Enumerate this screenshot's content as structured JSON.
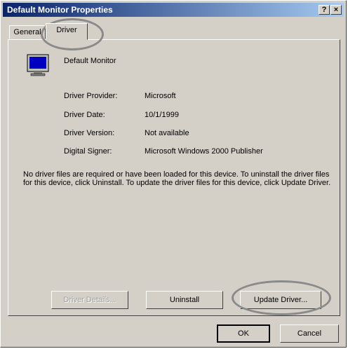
{
  "window": {
    "title": "Default Monitor Properties",
    "help_btn": "?",
    "close_btn": "×"
  },
  "tabs": [
    {
      "label": "General"
    },
    {
      "label": "Driver"
    }
  ],
  "device": {
    "name": "Default Monitor",
    "icon": "monitor-icon"
  },
  "details": [
    {
      "label": "Driver Provider:",
      "value": "Microsoft"
    },
    {
      "label": "Driver Date:",
      "value": "10/1/1999"
    },
    {
      "label": "Driver Version:",
      "value": "Not available"
    },
    {
      "label": "Digital Signer:",
      "value": "Microsoft Windows 2000 Publisher"
    }
  ],
  "description": "No driver files are required or have been loaded for this device. To uninstall the driver files for this device, click Uninstall. To update the driver files for this device, click Update Driver.",
  "buttons": {
    "driver_details": "Driver Details...",
    "uninstall": "Uninstall",
    "update_driver": "Update Driver...",
    "ok": "OK",
    "cancel": "Cancel"
  },
  "colors": {
    "titlebar_start": "#0a246a",
    "titlebar_end": "#a6caf0",
    "face": "#d4d0c8",
    "highlight_oval": "#8a8a8a"
  }
}
